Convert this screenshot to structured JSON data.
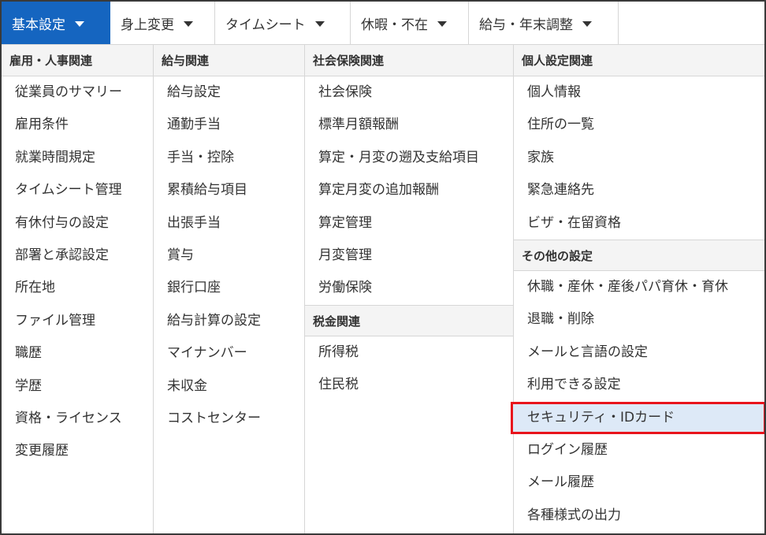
{
  "nav": {
    "tabs": [
      {
        "label": "基本設定",
        "active": true
      },
      {
        "label": "身上変更",
        "active": false
      },
      {
        "label": "タイムシート",
        "active": false
      },
      {
        "label": "休暇・不在",
        "active": false
      },
      {
        "label": "給与・年末調整",
        "active": false
      }
    ]
  },
  "columns": [
    {
      "sections": [
        {
          "header": "雇用・人事関連",
          "items": [
            "従業員のサマリー",
            "雇用条件",
            "就業時間規定",
            "タイムシート管理",
            "有休付与の設定",
            "部署と承認設定",
            "所在地",
            "ファイル管理",
            "職歴",
            "学歴",
            "資格・ライセンス",
            "変更履歴"
          ]
        }
      ]
    },
    {
      "sections": [
        {
          "header": "給与関連",
          "items": [
            "給与設定",
            "通勤手当",
            "手当・控除",
            "累積給与項目",
            "出張手当",
            "賞与",
            "銀行口座",
            "給与計算の設定",
            "マイナンバー",
            "未収金",
            "コストセンター"
          ]
        }
      ]
    },
    {
      "sections": [
        {
          "header": "社会保険関連",
          "items": [
            "社会保険",
            "標準月額報酬",
            "算定・月変の遡及支給項目",
            "算定月変の追加報酬",
            "算定管理",
            "月変管理",
            "労働保険"
          ]
        },
        {
          "header": "税金関連",
          "items": [
            "所得税",
            "住民税"
          ]
        }
      ]
    },
    {
      "sections": [
        {
          "header": "個人設定関連",
          "items": [
            "個人情報",
            "住所の一覧",
            "家族",
            "緊急連絡先",
            "ビザ・在留資格"
          ]
        },
        {
          "header": "その他の設定",
          "items": [
            "休職・産休・産後パパ育休・育休",
            "退職・削除",
            "メールと言語の設定",
            "利用できる設定",
            "セキュリティ・IDカード",
            "ログイン履歴",
            "メール履歴",
            "各種様式の出力"
          ]
        }
      ]
    }
  ],
  "highlighted_item": "セキュリティ・IDカード",
  "colors": {
    "active_tab": "#1565c0",
    "highlight_bg": "#dde9f7",
    "highlight_border": "#e8141c"
  }
}
